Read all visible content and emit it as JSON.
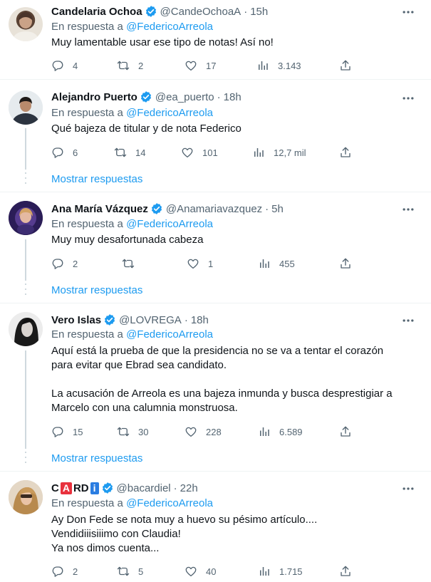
{
  "replying_prefix": "En respuesta a",
  "show_replies_label": "Mostrar respuestas",
  "colors": {
    "link": "#1d9bf0",
    "secondary": "#536471",
    "text": "#0f1419",
    "verified": "#1d9bf0"
  },
  "tweets": [
    {
      "name": "Candelaria Ochoa",
      "handle": "@CandeOchoaA",
      "time": "15h",
      "reply_to": "@FedericoArreola",
      "lines": [
        "Muy lamentable usar ese tipo de notas! Así no!"
      ],
      "replies": "4",
      "retweets": "2",
      "likes": "17",
      "views": "3.143"
    },
    {
      "name": "Alejandro Puerto",
      "handle": "@ea_puerto",
      "time": "18h",
      "reply_to": "@FedericoArreola",
      "lines": [
        "Qué bajeza de titular y de nota Federico"
      ],
      "replies": "6",
      "retweets": "14",
      "likes": "101",
      "views": "12,7 mil"
    },
    {
      "name": "Ana María Vázquez",
      "handle": "@Anamariavazquez",
      "time": "5h",
      "reply_to": "@FedericoArreola",
      "lines": [
        "Muy muy desafortunada cabeza"
      ],
      "replies": "2",
      "retweets": "",
      "likes": "1",
      "views": "455"
    },
    {
      "name": "Vero Islas",
      "handle": "@LOVREGA",
      "time": "18h",
      "reply_to": "@FedericoArreola",
      "lines": [
        "Aquí está la prueba de que la presidencia no se va a tentar el corazón",
        "para evitar que  Ebrad sea candidato.",
        "",
        "La acusación de Arreola es una bajeza inmunda y busca desprestigiar a",
        "Marcelo con una calumnia monstruosa."
      ],
      "replies": "15",
      "retweets": "30",
      "likes": "228",
      "views": "6.589"
    },
    {
      "name_parts": [
        "C",
        "A",
        "RD",
        "i"
      ],
      "handle": "@bacardiel",
      "time": "22h",
      "reply_to": "@FedericoArreola",
      "lines": [
        "Ay Don Fede se nota muy a huevo su pésimo artículo....",
        "Vendidiiisiiimo con Claudia!",
        "Ya nos dimos cuenta..."
      ],
      "replies": "2",
      "retweets": "5",
      "likes": "40",
      "views": "1.715"
    }
  ]
}
